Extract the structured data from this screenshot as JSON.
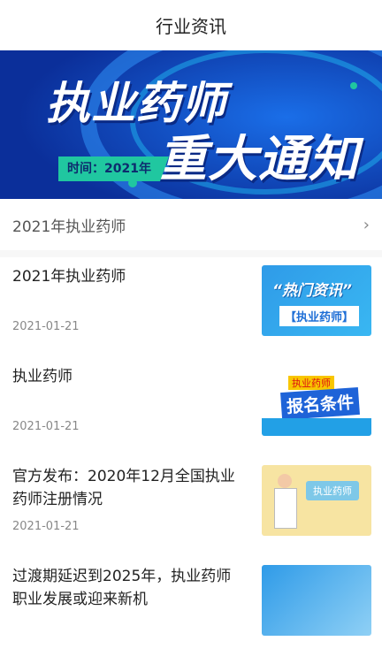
{
  "header": {
    "title": "行业资讯"
  },
  "banner": {
    "title_line1": "执业药师",
    "title_line2": "重大通知",
    "time_label": "时间：2021年"
  },
  "category": {
    "label": "2021年执业药师",
    "chevron_icon": "chevron-right-icon"
  },
  "articles": [
    {
      "title": "2021年执业药师",
      "date": "2021-01-21",
      "thumb": {
        "line1": "“热门资讯”",
        "line2": "【执业药师】"
      }
    },
    {
      "title": "执业药师",
      "date": "2021-01-21",
      "thumb": {
        "line1": "执业药师",
        "line2": "报名条件"
      }
    },
    {
      "title": "官方发布：2020年12月全国执业药师注册情况",
      "date": "2021-01-21",
      "thumb": {
        "line1": "执业药师"
      }
    },
    {
      "title": "过渡期延迟到2025年，执业药师职业发展或迎来新机",
      "date": "",
      "thumb": {}
    }
  ],
  "colors": {
    "banner_bg": "#0d3fb8",
    "accent_green": "#20c7a0"
  }
}
